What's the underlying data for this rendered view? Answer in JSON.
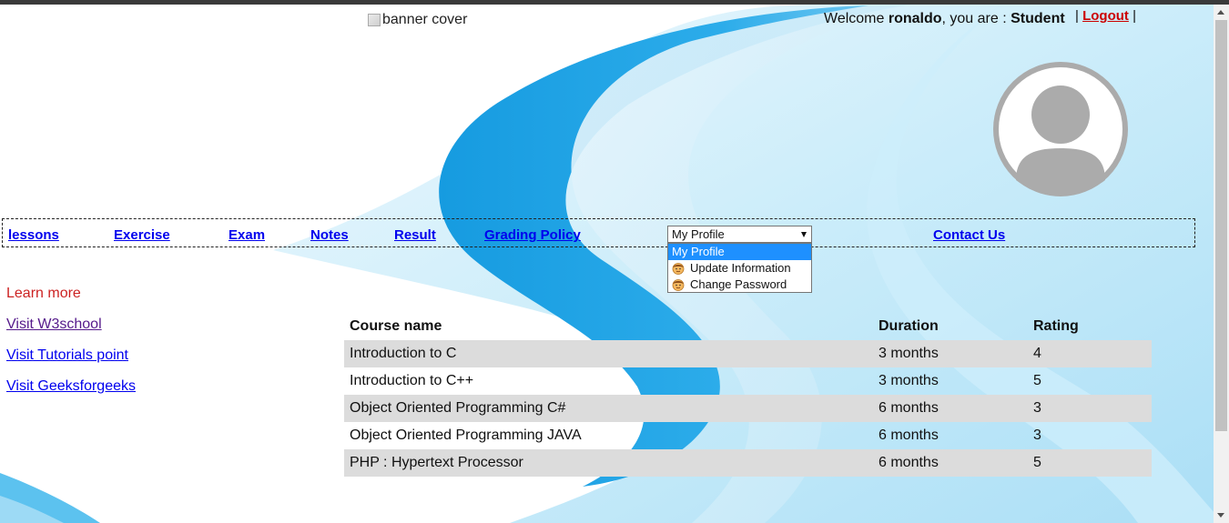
{
  "banner": {
    "alt_text": "banner cover"
  },
  "welcome": {
    "prefix": "Welcome",
    "username": "ronaldo",
    "middle": ", you are :",
    "role": "Student"
  },
  "nav": {
    "links": [
      {
        "label": "lessons"
      },
      {
        "label": "Exercise"
      },
      {
        "label": "Exam"
      },
      {
        "label": "Notes"
      },
      {
        "label": "Result"
      },
      {
        "label": "Grading Policy"
      }
    ],
    "contact_label": "Contact Us",
    "logout_label": "Logout",
    "separator": "|"
  },
  "profile_menu": {
    "selected": "My Profile",
    "options": [
      "My Profile",
      "Update Information",
      "Change Password"
    ]
  },
  "side_links": {
    "heading": "Learn more",
    "links": [
      "Visit W3school",
      "Visit Tutorials point",
      "Visit Geeksforgeeks"
    ]
  },
  "course_table": {
    "headers": [
      "Course name",
      "Duration",
      "Rating"
    ],
    "rows": [
      [
        "Introduction to C",
        "3 months",
        "4"
      ],
      [
        "Introduction to C++",
        "3 months",
        "5"
      ],
      [
        "Object Oriented Programming C#",
        "6 months",
        "3"
      ],
      [
        "Object Oriented Programming JAVA",
        "6 months",
        "3"
      ],
      [
        "PHP : Hypertext Processor",
        "6 months",
        "5"
      ]
    ]
  },
  "colors": {
    "link": "#0000ee",
    "visited_link": "#551a8b",
    "logout": "#cc0000",
    "learn_more": "#cc2222",
    "row_shade": "#dcdcdc",
    "wave_dark": "#2aa6e6",
    "wave_light": "#bfe7f8"
  }
}
